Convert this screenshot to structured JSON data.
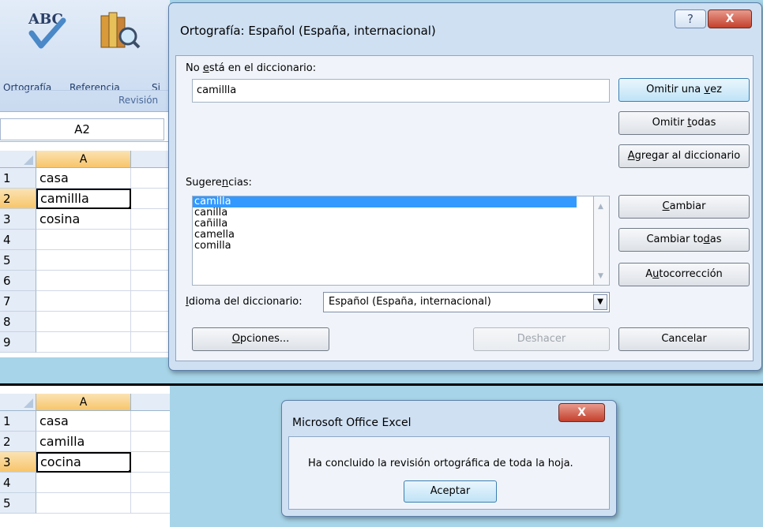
{
  "ribbon": {
    "spelling_label": "Ortografía",
    "reference_label": "Referencia",
    "cut_label": "Si",
    "group_label": "Revisión"
  },
  "namebox": "A2",
  "sheet_before": {
    "column_header": "A",
    "rows": [
      {
        "num": "1",
        "value": "casa"
      },
      {
        "num": "2",
        "value": "camillla"
      },
      {
        "num": "3",
        "value": "cosina"
      },
      {
        "num": "4",
        "value": ""
      },
      {
        "num": "5",
        "value": ""
      },
      {
        "num": "6",
        "value": ""
      },
      {
        "num": "7",
        "value": ""
      },
      {
        "num": "8",
        "value": ""
      },
      {
        "num": "9",
        "value": ""
      }
    ]
  },
  "sheet_after": {
    "column_header": "A",
    "rows": [
      {
        "num": "1",
        "value": "casa"
      },
      {
        "num": "2",
        "value": "camilla"
      },
      {
        "num": "3",
        "value": "cocina"
      },
      {
        "num": "4",
        "value": ""
      },
      {
        "num": "5",
        "value": ""
      }
    ]
  },
  "spelling_dialog": {
    "title": "Ortografía: Español (España, internacional)",
    "help_glyph": "?",
    "close_glyph": "X",
    "not_in_dict_label_pre": "No ",
    "not_in_dict_label_u": "e",
    "not_in_dict_label_post": "stá en el diccionario:",
    "not_in_dict_value": "camillla",
    "suggestions_label_pre": "Sugere",
    "suggestions_label_u": "n",
    "suggestions_label_post": "cias:",
    "suggestions": [
      "camilla",
      "canilla",
      "cañilla",
      "camella",
      "comilla"
    ],
    "language_label_u": "I",
    "language_label_post": "dioma del diccionario:",
    "language_value": "Español (España, internacional)",
    "buttons": {
      "ignore_once_pre": "Omitir una ",
      "ignore_once_u": "v",
      "ignore_once_post": "ez",
      "ignore_all_pre": "Omitir ",
      "ignore_all_u": "t",
      "ignore_all_post": "odas",
      "add_u": "A",
      "add_post": "gregar al diccionario",
      "change_u": "C",
      "change_post": "ambiar",
      "change_all_pre": "Cambiar to",
      "change_all_u": "d",
      "change_all_post": "as",
      "autocorrect_pre": "A",
      "autocorrect_u": "u",
      "autocorrect_post": "tocorrección",
      "options_u": "O",
      "options_post": "pciones...",
      "undo": "Deshacer",
      "cancel": "Cancelar"
    }
  },
  "message_box": {
    "title": "Microsoft Office Excel",
    "close_glyph": "X",
    "message": "Ha concluido la revisión ortográfica de toda la hoja.",
    "ok": "Aceptar"
  }
}
